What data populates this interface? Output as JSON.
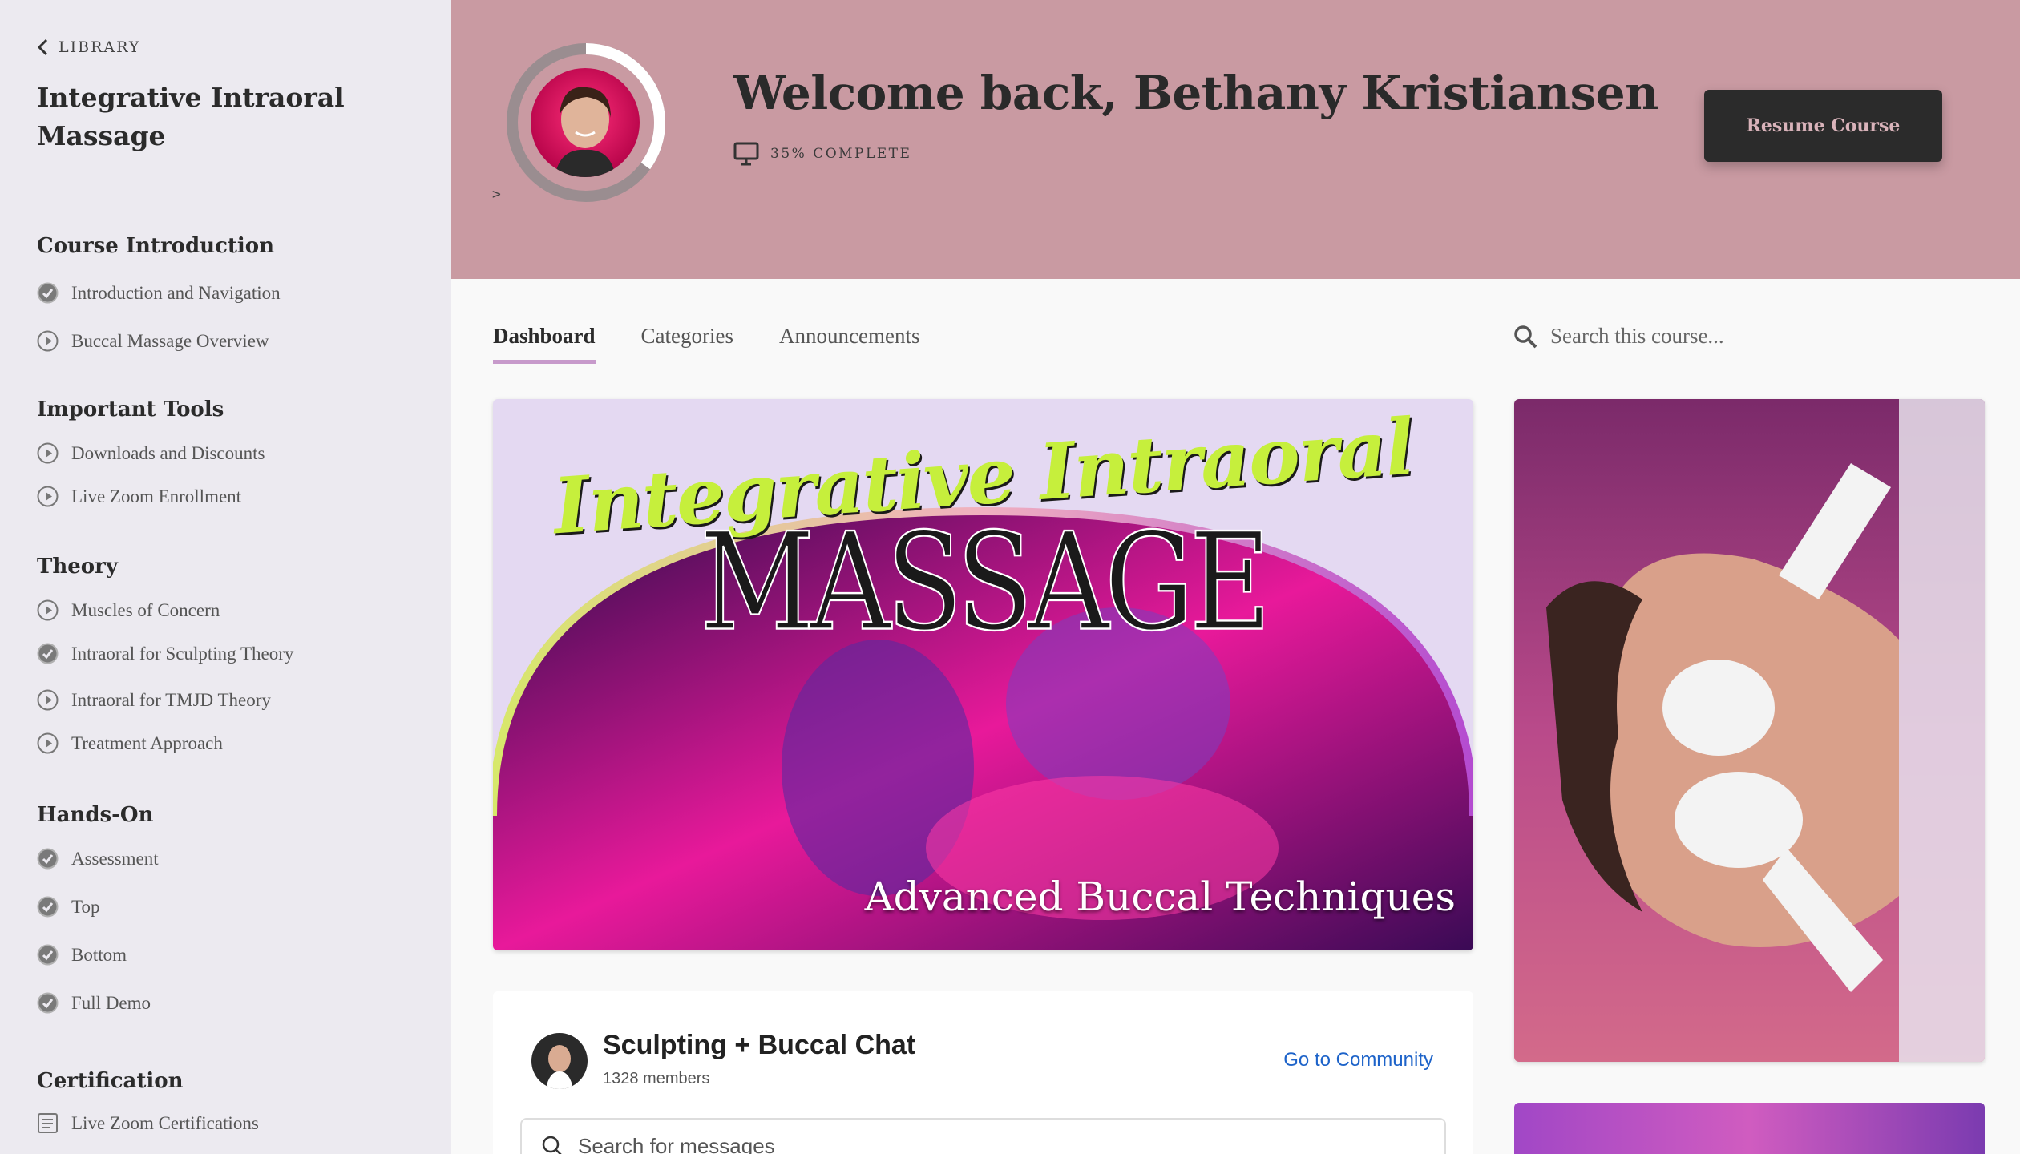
{
  "sidebar": {
    "back_label": "LIBRARY",
    "course_title": "Integrative Intraoral Massage",
    "sections": [
      {
        "title": "Course Introduction",
        "lessons": [
          {
            "label": "Introduction and Navigation",
            "status": "completed"
          },
          {
            "label": "Buccal Massage Overview",
            "status": "play"
          }
        ]
      },
      {
        "title": "Important Tools",
        "lessons": [
          {
            "label": "Downloads and Discounts",
            "status": "play"
          },
          {
            "label": "Live Zoom Enrollment",
            "status": "play"
          }
        ]
      },
      {
        "title": "Theory",
        "lessons": [
          {
            "label": "Muscles of Concern",
            "status": "play"
          },
          {
            "label": "Intraoral for Sculpting Theory",
            "status": "completed"
          },
          {
            "label": "Intraoral for TMJD Theory",
            "status": "play"
          },
          {
            "label": "Treatment Approach",
            "status": "play"
          }
        ]
      },
      {
        "title": "Hands-On",
        "lessons": [
          {
            "label": "Assessment",
            "status": "completed"
          },
          {
            "label": "Top",
            "status": "completed"
          },
          {
            "label": "Bottom",
            "status": "completed"
          },
          {
            "label": "Full Demo",
            "status": "completed"
          }
        ]
      },
      {
        "title": "Certification",
        "lessons": [
          {
            "label": "Live Zoom Certifications",
            "status": "document"
          }
        ]
      }
    ]
  },
  "hero": {
    "caret": ">",
    "welcome": "Welcome back, Bethany Kristiansen",
    "progress_label": "35% COMPLETE",
    "progress_value": 0.35,
    "resume_label": "Resume Course",
    "background_color": "#c99aa2"
  },
  "tabs": [
    {
      "label": "Dashboard",
      "active": true
    },
    {
      "label": "Categories",
      "active": false
    },
    {
      "label": "Announcements",
      "active": false
    }
  ],
  "search": {
    "placeholder": "Search this course..."
  },
  "banner": {
    "script_text": "Integrative Intraoral",
    "title": "MASSAGE",
    "subtitle": "Advanced Buccal Techniques"
  },
  "community": {
    "name": "Sculpting + Buccal Chat",
    "members": "1328 members",
    "link_label": "Go to Community",
    "search_placeholder": "Search for messages"
  },
  "icons": {
    "completed": "check-circle-icon",
    "play": "play-circle-icon",
    "document": "document-icon",
    "back": "chevron-left-icon",
    "progress": "monitor-icon",
    "search": "search-icon"
  },
  "colors": {
    "sidebar_bg": "#eceaf0",
    "accent_tab": "#c79acb",
    "resume_bg": "#2b2b2b",
    "link": "#1d63c9"
  }
}
